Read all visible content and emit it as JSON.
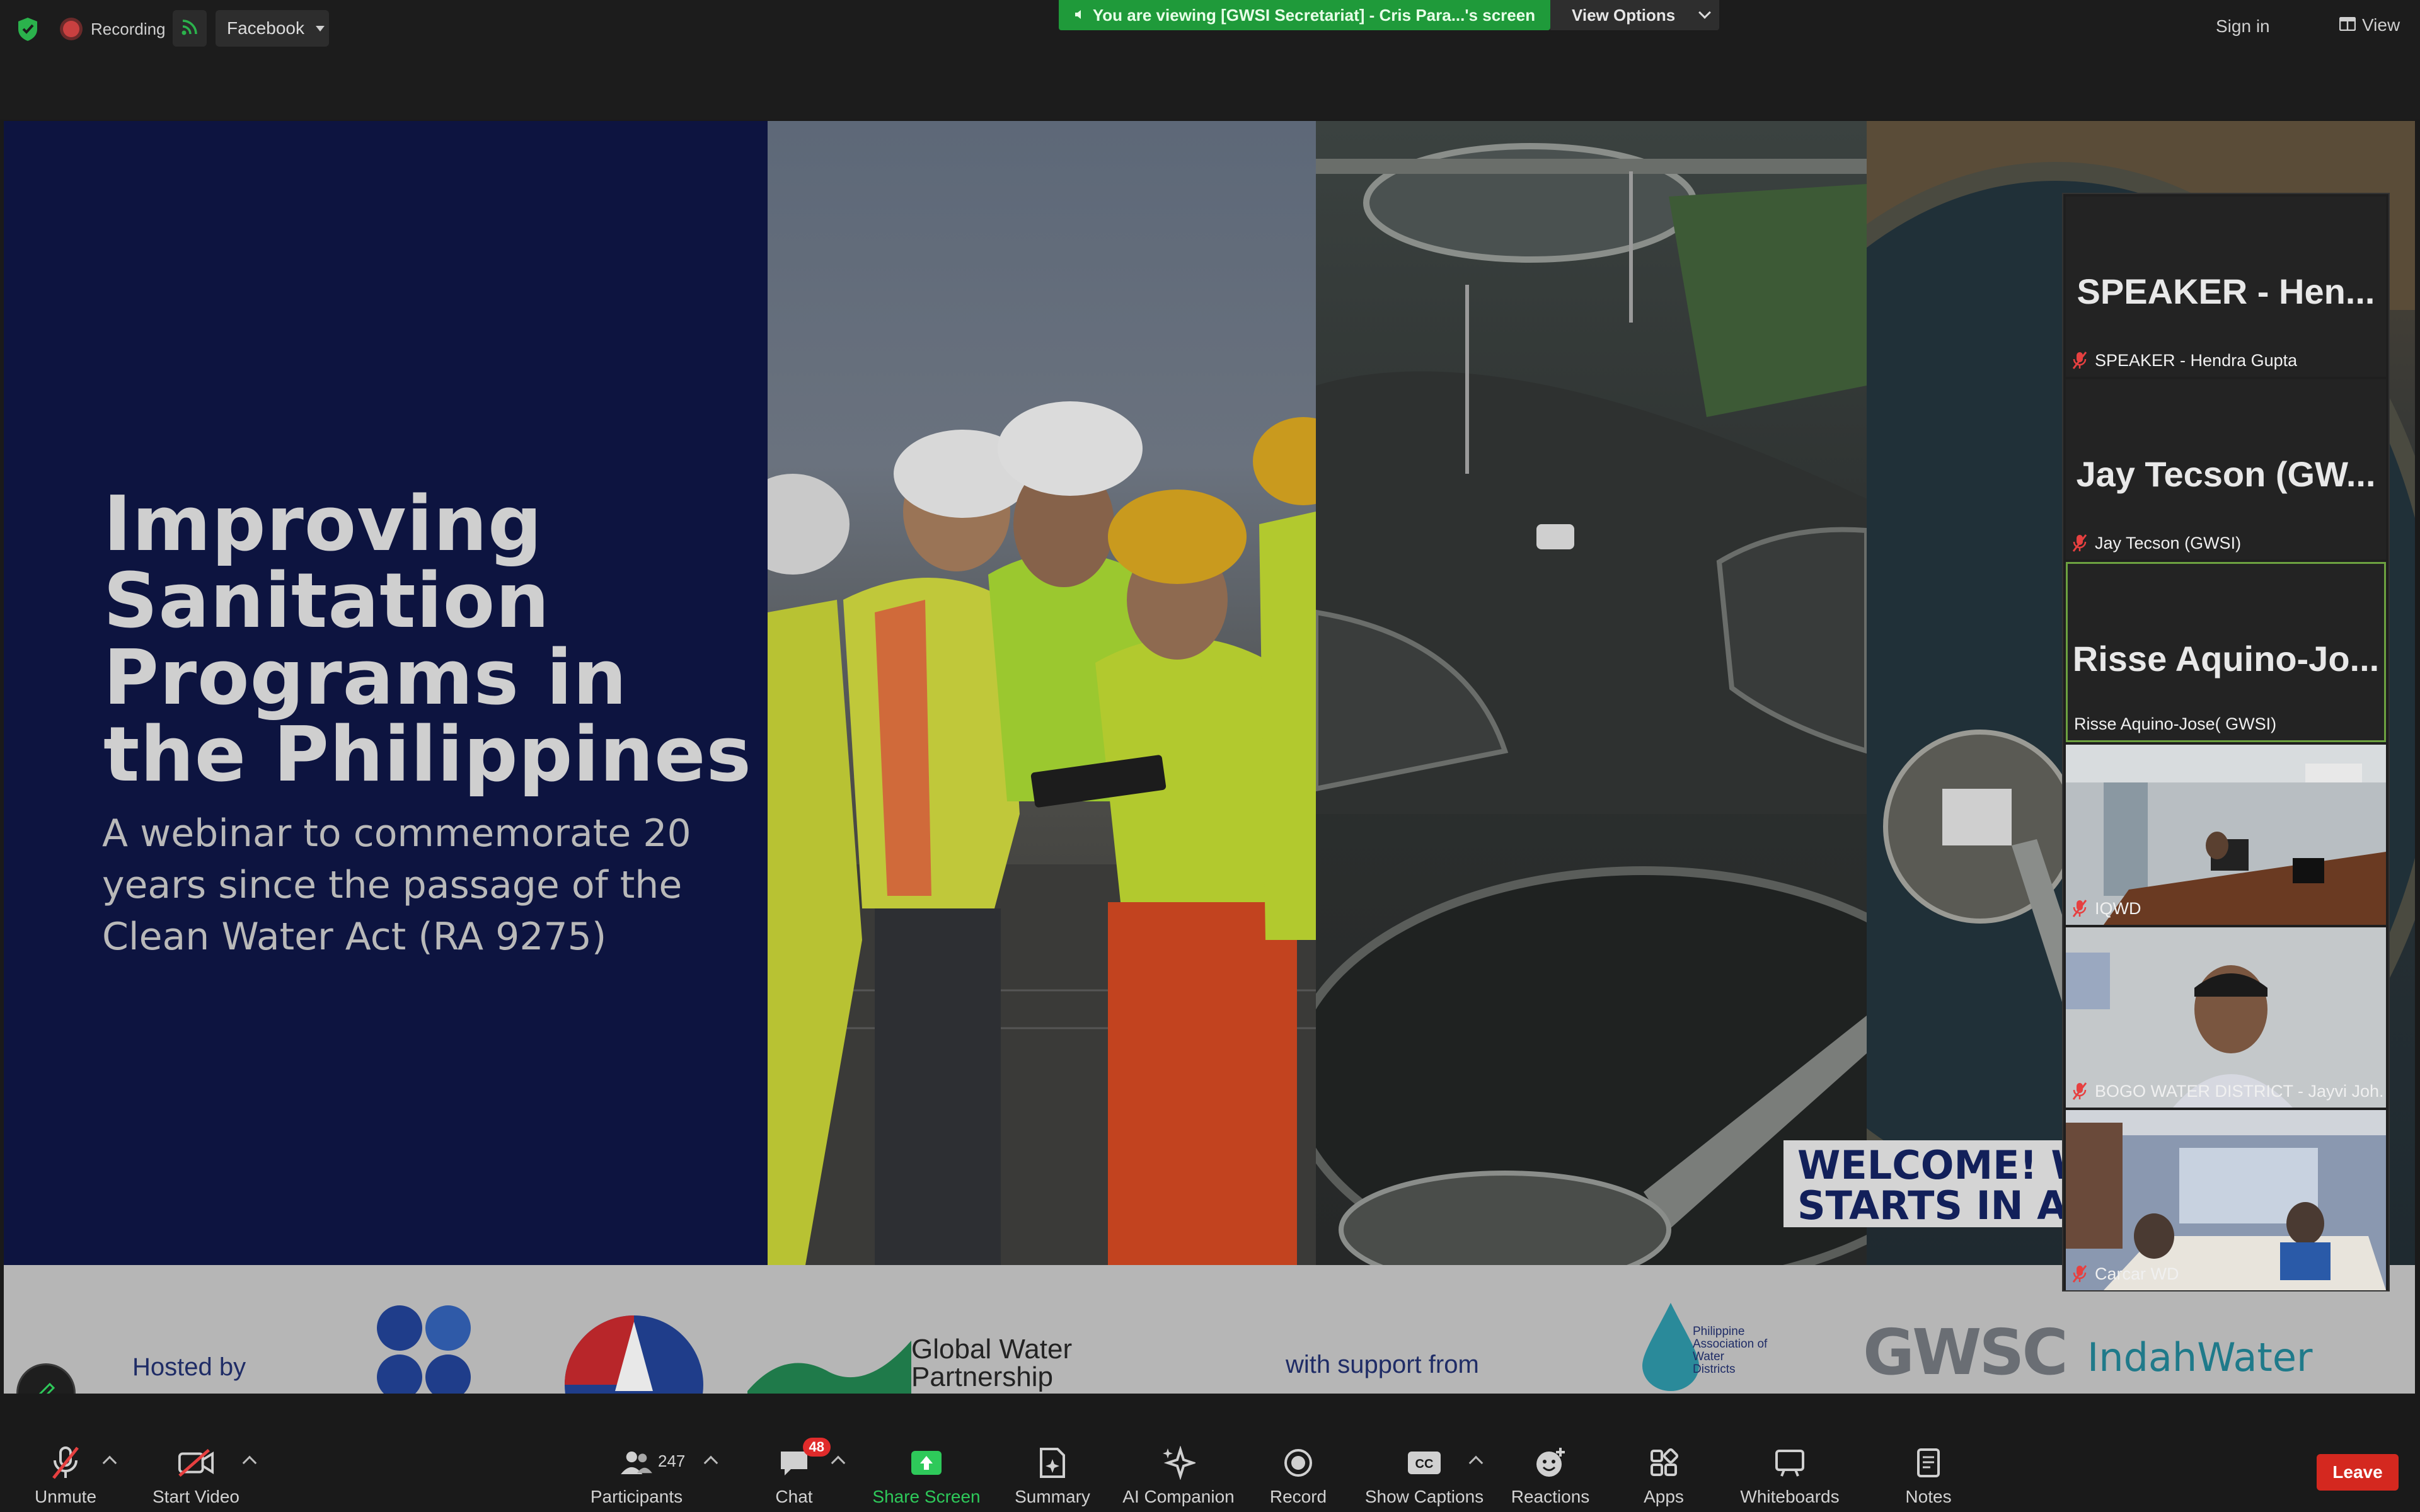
{
  "topbar": {
    "recording_label": "Recording",
    "stream_target": "Facebook",
    "viewing_banner": "You are viewing [GWSI Secretariat] - Cris Para...'s screen",
    "view_options_label": "View Options",
    "signin_label": "Sign in",
    "view_label": "View"
  },
  "slide": {
    "title_lines": [
      "Improving",
      "Sanitation",
      "Programs in",
      "the Philippines"
    ],
    "subtitle_lines": [
      "A webinar to commemorate 20",
      "years since the passage of the",
      "Clean Water Act (RA 9275)"
    ],
    "welcome_lines": [
      "WELCOME! WE",
      "STARTS IN A F"
    ],
    "hosted_by": "Hosted by",
    "with_support": "with support from",
    "gwp_lines": [
      "Global Water",
      "Partnership"
    ],
    "paw_lines": [
      "Philippine",
      "Association of",
      "Water",
      "Districts"
    ],
    "gwsc_logo": "GWSC",
    "indah_logo": "IndahWater"
  },
  "gallery": {
    "tiles": [
      {
        "big": "SPEAKER - Hen...",
        "name": "SPEAKER - Hendra Gupta",
        "type": "name",
        "active": false
      },
      {
        "big": "Jay Tecson (GW...",
        "name": "Jay Tecson (GWSI)",
        "type": "name",
        "active": false
      },
      {
        "big": "Risse Aquino-Jo...",
        "name": "Risse Aquino-Jose( GWSI)",
        "type": "name",
        "active": true
      },
      {
        "big": "",
        "name": "IQWD",
        "type": "video",
        "active": false
      },
      {
        "big": "",
        "name": "BOGO WATER DISTRICT - Jayvi Joh...",
        "type": "video",
        "active": false
      },
      {
        "big": "",
        "name": "Carcar WD",
        "type": "video",
        "active": false
      }
    ]
  },
  "toolbar": {
    "unmute": "Unmute",
    "start_video": "Start Video",
    "participants": "Participants",
    "participants_count": "247",
    "chat": "Chat",
    "chat_badge": "48",
    "share_screen": "Share Screen",
    "summary": "Summary",
    "ai_companion": "AI Companion",
    "record": "Record",
    "show_captions": "Show Captions",
    "reactions": "Reactions",
    "apps": "Apps",
    "whiteboards": "Whiteboards",
    "notes": "Notes",
    "leave": "Leave"
  },
  "colors": {
    "banner_green": "#1f9a3a",
    "share_green": "#2ec95a",
    "leave_red": "#d4281f",
    "active_border": "#6da240",
    "slide_navy": "#0d1440"
  }
}
